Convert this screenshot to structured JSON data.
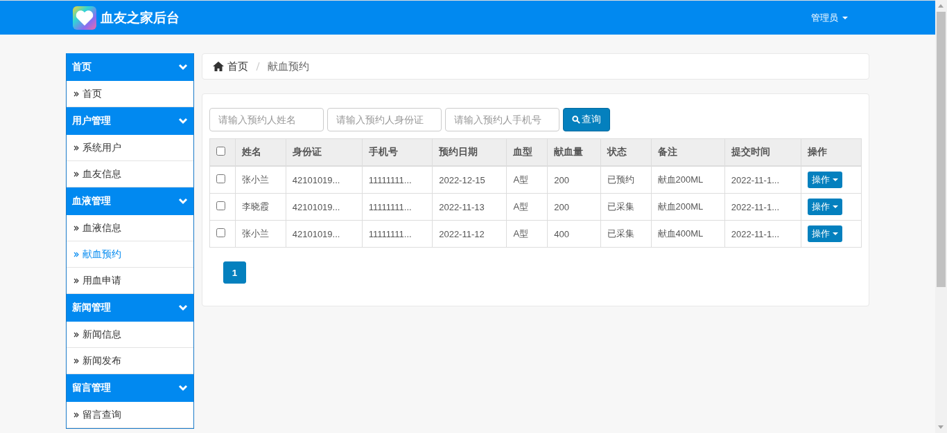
{
  "header": {
    "title": "血友之家后台",
    "user": "管理员"
  },
  "sidebar": {
    "groups": [
      {
        "title": "首页",
        "expanded": true,
        "items": [
          {
            "label": "首页",
            "selected": false
          }
        ]
      },
      {
        "title": "用户管理",
        "expanded": true,
        "items": [
          {
            "label": "系统用户",
            "selected": false
          },
          {
            "label": "血友信息",
            "selected": false
          }
        ]
      },
      {
        "title": "血液管理",
        "expanded": true,
        "items": [
          {
            "label": "血液信息",
            "selected": false
          },
          {
            "label": "献血预约",
            "selected": true
          },
          {
            "label": "用血申请",
            "selected": false
          }
        ]
      },
      {
        "title": "新闻管理",
        "expanded": true,
        "items": [
          {
            "label": "新闻信息",
            "selected": false
          },
          {
            "label": "新闻发布",
            "selected": false
          }
        ]
      },
      {
        "title": "留言管理",
        "expanded": true,
        "items": [
          {
            "label": "留言查询",
            "selected": false
          }
        ]
      }
    ]
  },
  "breadcrumb": [
    "首页",
    "献血预约"
  ],
  "search": {
    "fields": [
      {
        "placeholder": "请输入预约人姓名"
      },
      {
        "placeholder": "请输入预约人身份证"
      },
      {
        "placeholder": "请输入预约人手机号"
      }
    ],
    "button": "查询"
  },
  "table": {
    "select_all": false,
    "columns": [
      "姓名",
      "身份证",
      "手机号",
      "预约日期",
      "血型",
      "献血量",
      "状态",
      "备注",
      "提交时间",
      "操作"
    ],
    "rows": [
      {
        "checked": false,
        "cells": [
          "张小兰",
          "42101019...",
          "11111111...",
          "2022-12-15",
          "A型",
          "200",
          "已预约",
          "献血200ML",
          "2022-11-1..."
        ],
        "action": "操作"
      },
      {
        "checked": false,
        "cells": [
          "李晓霞",
          "42101019...",
          "11111111...",
          "2022-11-13",
          "A型",
          "200",
          "已采集",
          "献血200ML",
          "2022-11-1..."
        ],
        "action": "操作"
      },
      {
        "checked": false,
        "cells": [
          "张小兰",
          "42101019...",
          "11111111...",
          "2022-11-12",
          "A型",
          "400",
          "已采集",
          "献血400ML",
          "2022-11-1..."
        ],
        "action": "操作"
      }
    ]
  },
  "pagination": [
    {
      "label": "1",
      "selected": true
    }
  ]
}
